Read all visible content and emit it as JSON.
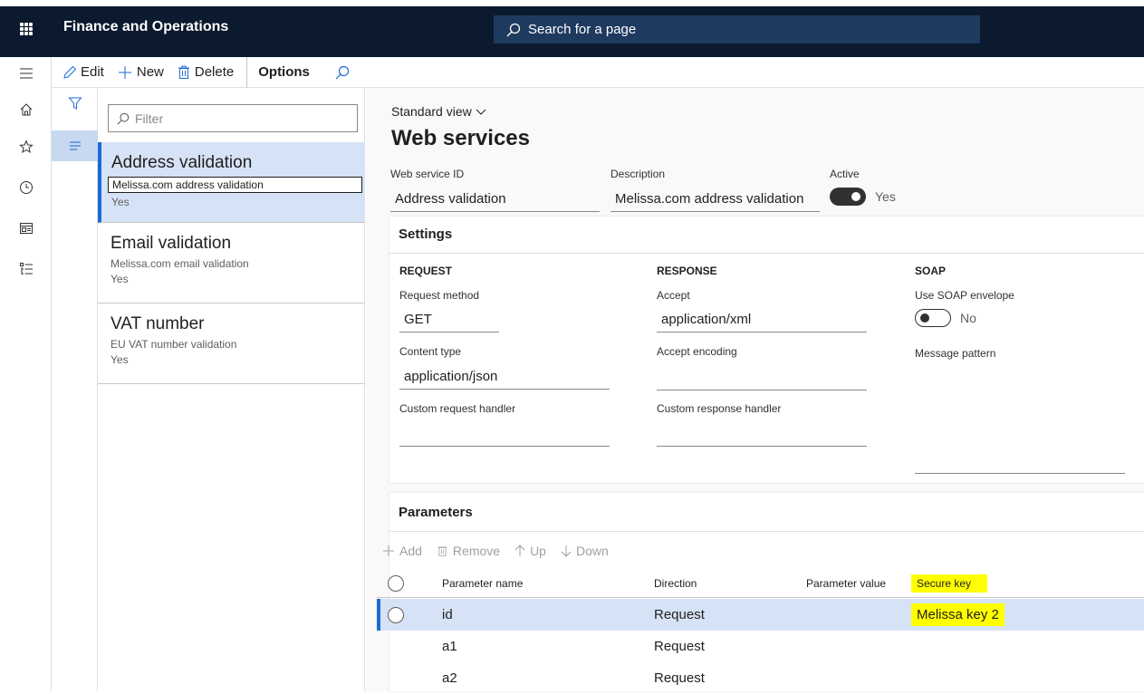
{
  "nav": {
    "app_title": "Finance and Operations",
    "search_placeholder": "Search for a page"
  },
  "commands": {
    "edit": "Edit",
    "new": "New",
    "delete": "Delete",
    "options": "Options"
  },
  "list": {
    "filter_placeholder": "Filter",
    "items": [
      {
        "title": "Address validation",
        "description": "Melissa.com address validation",
        "active": "Yes"
      },
      {
        "title": "Email validation",
        "description": "Melissa.com email validation",
        "active": "Yes"
      },
      {
        "title": "VAT number",
        "description": "EU VAT number validation",
        "active": "Yes"
      }
    ]
  },
  "header": {
    "view": "Standard view",
    "title": "Web services",
    "web_service_id_label": "Web service ID",
    "web_service_id": "Address validation",
    "description_label": "Description",
    "description": "Melissa.com address validation",
    "active_label": "Active",
    "active": "Yes"
  },
  "settings": {
    "title": "Settings",
    "request": {
      "group": "REQUEST",
      "method_label": "Request method",
      "method": "GET",
      "content_type_label": "Content type",
      "content_type": "application/json",
      "custom_handler_label": "Custom request handler",
      "custom_handler": ""
    },
    "response": {
      "group": "RESPONSE",
      "accept_label": "Accept",
      "accept": "application/xml",
      "accept_encoding_label": "Accept encoding",
      "accept_encoding": "",
      "custom_handler_label": "Custom response handler",
      "custom_handler": ""
    },
    "soap": {
      "group": "SOAP",
      "envelope_label": "Use SOAP envelope",
      "envelope": "No",
      "pattern_label": "Message pattern",
      "pattern": ""
    }
  },
  "parameters": {
    "title": "Parameters",
    "actions": {
      "add": "Add",
      "remove": "Remove",
      "up": "Up",
      "down": "Down"
    },
    "columns": {
      "name": "Parameter name",
      "direction": "Direction",
      "value": "Parameter value",
      "secure": "Secure key"
    },
    "rows": [
      {
        "name": "id",
        "direction": "Request",
        "value": "",
        "secure": "Melissa key 2"
      },
      {
        "name": "a1",
        "direction": "Request",
        "value": "",
        "secure": ""
      },
      {
        "name": "a2",
        "direction": "Request",
        "value": "",
        "secure": ""
      }
    ]
  },
  "colors": {
    "navbar": "#0b1a2e",
    "selection": "#d6e2f5",
    "accent": "#1d6ad6",
    "highlight": "#ffff00"
  }
}
